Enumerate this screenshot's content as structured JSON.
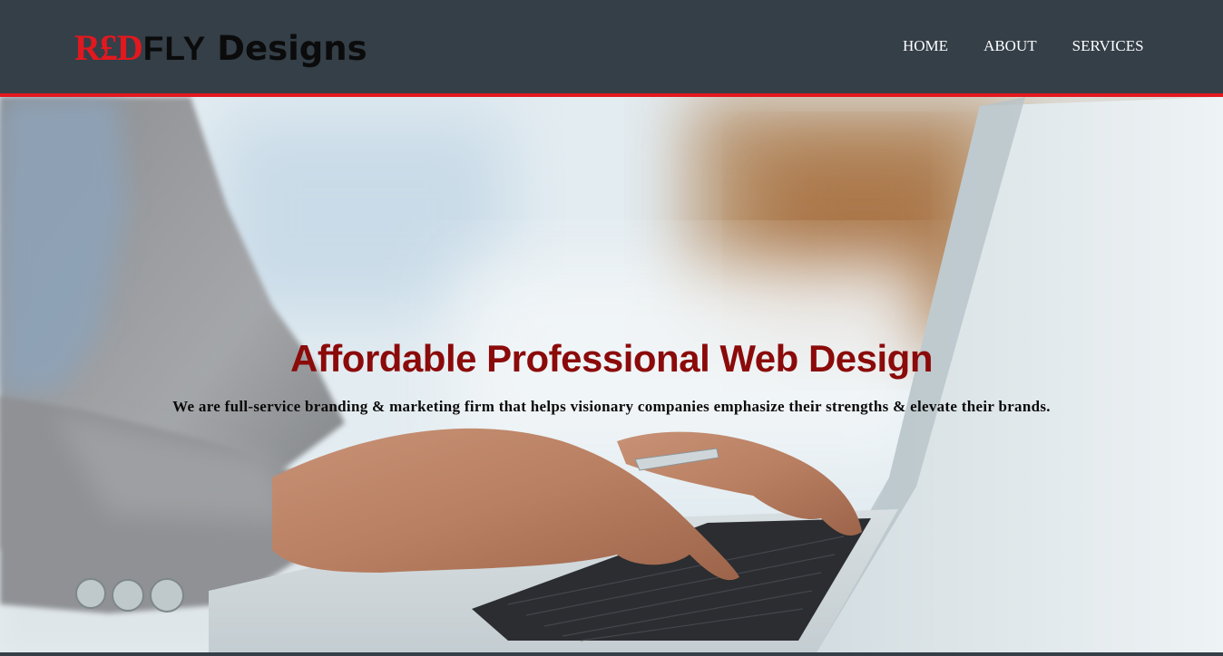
{
  "header": {
    "brand": {
      "red_part": "R£D",
      "dark_part": "FLY",
      "suffix": "Designs"
    },
    "nav": [
      {
        "label": "HOME"
      },
      {
        "label": "ABOUT"
      },
      {
        "label": "SERVICES"
      }
    ]
  },
  "hero": {
    "title": "Affordable Professional Web Design",
    "subtitle": "We are full-service branding & marketing firm that helps visionary companies emphasize their strengths & elevate their brands.",
    "background_image": "person-typing-on-laptop-photo"
  },
  "colors": {
    "header_bg": "#343f48",
    "accent_red": "#e3181f",
    "title_red": "#8b0a0a",
    "nav_text": "#ffffff"
  }
}
